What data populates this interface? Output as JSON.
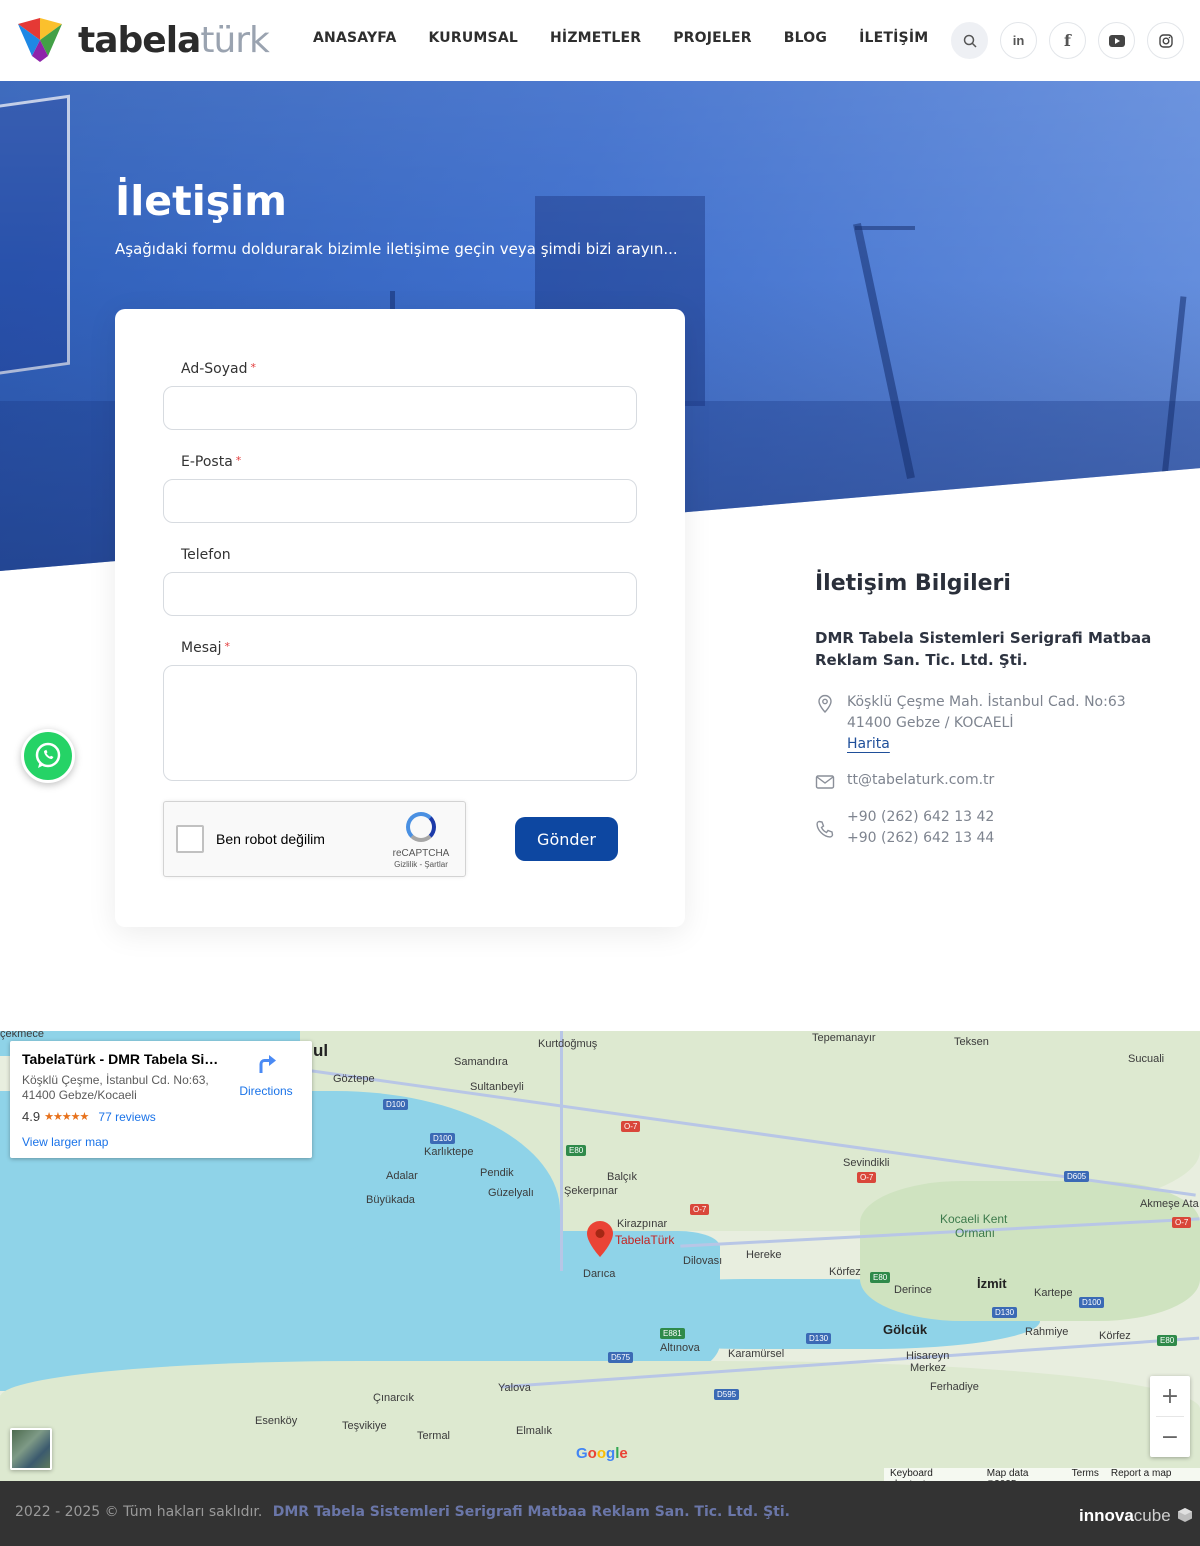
{
  "brand": {
    "logo_main": "tabela",
    "logo_accent": "türk"
  },
  "nav": {
    "items": [
      "ANASAYFA",
      "KURUMSAL",
      "HİZMETLER",
      "PROJELER",
      "BLOG",
      "İLETİŞİM"
    ]
  },
  "header_icons": [
    "search-icon",
    "linkedin-icon",
    "facebook-icon",
    "youtube-icon",
    "instagram-icon"
  ],
  "hero": {
    "title": "İletişim",
    "subtitle": "Aşağıdaki formu doldurarak bizimle iletişime geçin veya şimdi bizi arayın..."
  },
  "form": {
    "name_label": "Ad-Soyad",
    "email_label": "E-Posta",
    "phone_label": "Telefon",
    "message_label": "Mesaj",
    "required_mark": "*",
    "recaptcha_label": "Ben robot değilim",
    "recaptcha_brand": "reCAPTCHA",
    "recaptcha_terms": "Gizlilik - Şartlar",
    "submit_label": "Gönder"
  },
  "info": {
    "title": "İletişim Bilgileri",
    "company": "DMR Tabela Sistemleri Serigrafi Matbaa Reklam San. Tic. Ltd. Şti.",
    "address_line1": "Köşklü Çeşme Mah. İstanbul Cad. No:63",
    "address_line2": "41400 Gebze / KOCAELİ",
    "map_link": "Harita",
    "email": "tt@tabelaturk.com.tr",
    "phone1": "+90 (262) 642 13 42",
    "phone2": "+90 (262) 642 13 44"
  },
  "map": {
    "card_title": "TabelaTürk - DMR Tabela Sist...",
    "card_address": "Köşklü Çeşme, İstanbul Cd. No:63, 41400 Gebze/Kocaeli",
    "rating": "4.9",
    "stars": "★★★★★",
    "reviews": "77 reviews",
    "larger_map": "View larger map",
    "directions": "Directions",
    "pin_label": "TabelaTürk",
    "zoom_in": "+",
    "zoom_out": "−",
    "google": "Google",
    "attribution": [
      "Keyboard shortcuts",
      "Map data ©2025",
      "Terms",
      "Report a map error"
    ],
    "labels": {
      "cekmece": "çekmece",
      "ul": "ul",
      "kurtdogmus": "Kurtdoğmuş",
      "tepemanayir": "Tepemanayır",
      "teksen": "Teksen",
      "sucuali": "Sucuali",
      "samandira": "Samandıra",
      "goztepe": "Göztepe",
      "sultanbeyli": "Sultanbeyli",
      "karliktepe": "Karlıktepe",
      "balcik": "Balçık",
      "sevindikli": "Sevindikli",
      "adalar": "Adalar",
      "pendik": "Pendik",
      "guzelyali": "Güzelyalı",
      "sekerpinar": "Şekerpınar",
      "buyukada": "Büyükada",
      "kirazpinar": "Kirazpınar",
      "kocaeli_kent": "Kocaeli Kent",
      "ormani": "Ormanı",
      "akmese": "Akmeşe Ata",
      "hereke": "Hereke",
      "dilovasi": "Dilovası",
      "darica": "Darıca",
      "korfez": "Körfez",
      "izmit": "İzmit",
      "derince": "Derince",
      "kartepe": "Kartepe",
      "golcuk": "Gölcük",
      "rahmiye": "Rahmiye",
      "korfez2": "Körfez",
      "altinova": "Altınova",
      "karamursel": "Karamürsel",
      "hisareyn": "Hisareyn",
      "merkez": "Merkez",
      "ferhadiye": "Ferhadiye",
      "yalova": "Yalova",
      "cinarcik": "Çınarcık",
      "esenkoy": "Esenköy",
      "tesvikiye": "Teşvikiye",
      "termal": "Termal",
      "elmalik": "Elmalık"
    },
    "shields": {
      "d100a": "D100",
      "d100b": "D100",
      "e80a": "E80",
      "o7a": "O-7",
      "o7b": "O-7",
      "o7c": "O-7",
      "d605": "D605",
      "o7d": "O-7",
      "e80b": "E80",
      "d130a": "D130",
      "d100c": "D100",
      "e80c": "E80",
      "e881": "E881",
      "d130b": "D130",
      "d575": "D575",
      "d595": "D595"
    }
  },
  "footer": {
    "copyright": "2022 - 2025 © Tüm hakları saklıdır.",
    "company": "DMR Tabela Sistemleri Serigrafi Matbaa Reklam San. Tic. Ltd. Şti.",
    "brand_bold": "innova",
    "brand_light": "cube"
  },
  "colors": {
    "primary": "#0d47a1",
    "hero_blue": "#3f6fcc",
    "footer_bg": "#333333",
    "whatsapp": "#25d366",
    "required": "#e23b3b"
  }
}
